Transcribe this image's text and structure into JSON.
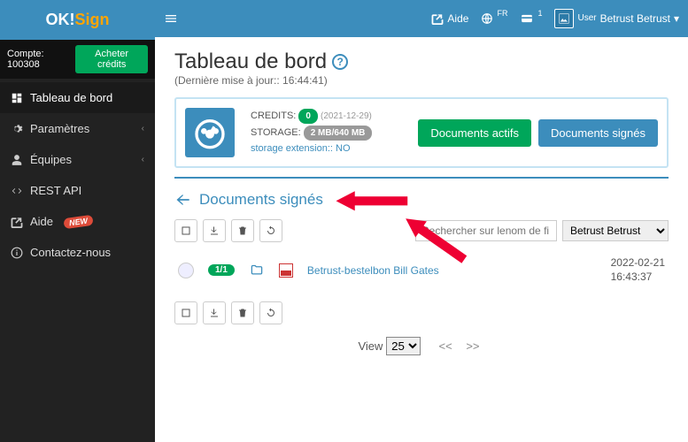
{
  "brand": {
    "part1": "OK!",
    "part2": "Sign"
  },
  "account": {
    "label": "Compte: 100308",
    "buy": "Acheter crédits"
  },
  "menu": {
    "dashboard": "Tableau de bord",
    "params": "Paramètres",
    "teams": "Équipes",
    "rest": "REST API",
    "help": "Aide",
    "new": "NEW",
    "contact": "Contactez-nous"
  },
  "topbar": {
    "help": "Aide",
    "lang": "FR",
    "user_alt": "User",
    "username": "Betrust Betrust"
  },
  "page": {
    "title": "Tableau de bord",
    "subtitle": "(Dernière mise à jour:: 16:44:41)"
  },
  "stats": {
    "credits_label": "CREDITS:",
    "credits_val": "0",
    "credits_date": "(2021-12-29)",
    "storage_label": "STORAGE:",
    "storage_val": "2 MB/640 MB",
    "ext_label": "storage extension:: NO"
  },
  "buttons": {
    "active": "Documents actifs",
    "signed": "Documents signés"
  },
  "section": {
    "title": "Documents signés"
  },
  "search": {
    "placeholder": "Rechercher sur lenom de fi"
  },
  "user_select": {
    "value": "Betrust Betrust"
  },
  "doc": {
    "count": "1/1",
    "name": "Betrust-bestelbon Bill Gates",
    "date": "2022-02-21",
    "time": "16:43:37"
  },
  "pager": {
    "view": "View",
    "size": "25",
    "prev": "<<",
    "next": ">>"
  }
}
